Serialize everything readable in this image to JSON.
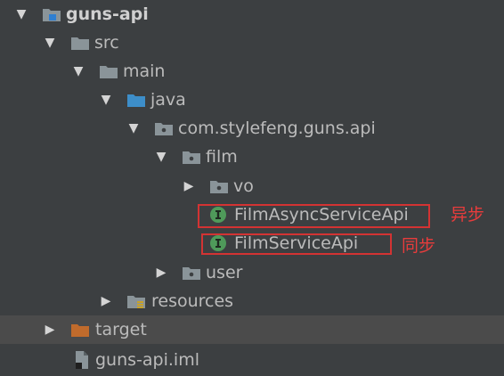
{
  "project_tree": {
    "root": "guns-api",
    "src": "src",
    "main": "main",
    "java": "java",
    "package": "com.stylefeng.guns.api",
    "film": "film",
    "vo": "vo",
    "async_service": "FilmAsyncServiceApi",
    "service": "FilmServiceApi",
    "user": "user",
    "resources": "resources",
    "target": "target",
    "iml": "guns-api.iml"
  },
  "annotations": {
    "async": "异步",
    "sync": "同步"
  },
  "icons": {
    "folder": "folder-icon",
    "module": "module-folder-icon",
    "source": "source-folder-icon",
    "package": "package-icon",
    "interface": "interface-icon",
    "resources": "resources-folder-icon",
    "excluded": "excluded-folder-icon",
    "file": "iml-file-icon"
  },
  "colors": {
    "background": "#3c3f41",
    "selection": "#4b4b4b",
    "folder": "#8a9499",
    "source_folder": "#3d8ec9",
    "excluded_folder": "#c06b2c",
    "interface": "#4f9a5a",
    "annotation": "#d33333"
  }
}
